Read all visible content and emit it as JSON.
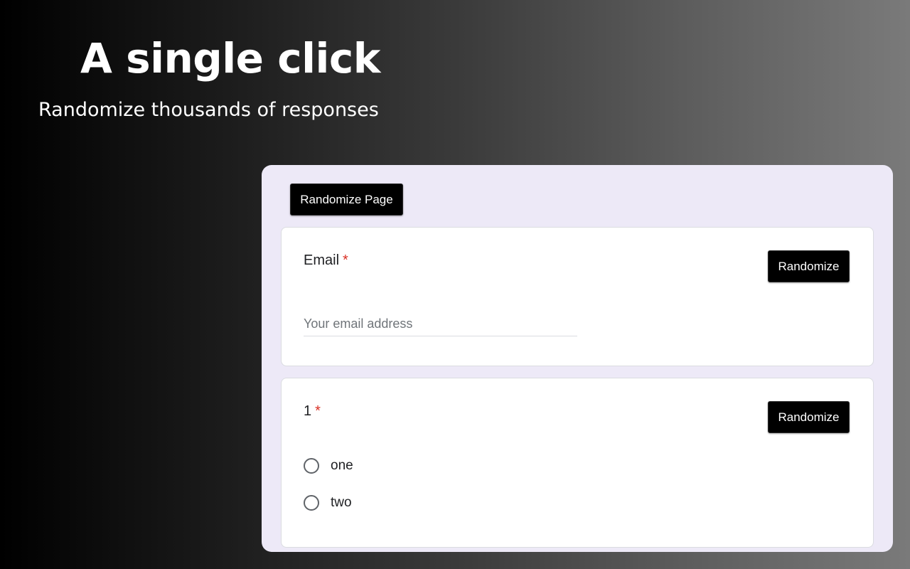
{
  "hero": {
    "title": "A single click",
    "subtitle": "Randomize thousands of responses"
  },
  "panel": {
    "randomize_page_label": "Randomize Page",
    "questions": [
      {
        "label": "Email",
        "required_mark": "*",
        "randomize_label": "Randomize",
        "input_placeholder": "Your email address"
      },
      {
        "label": "1",
        "required_mark": "*",
        "randomize_label": "Randomize",
        "options": [
          "one",
          "two"
        ]
      }
    ]
  },
  "colors": {
    "panel_background": "#ede9f7",
    "button_background": "#000000",
    "required_mark": "#d93025"
  },
  "icons": {
    "radio": "radio-unchecked-icon"
  }
}
